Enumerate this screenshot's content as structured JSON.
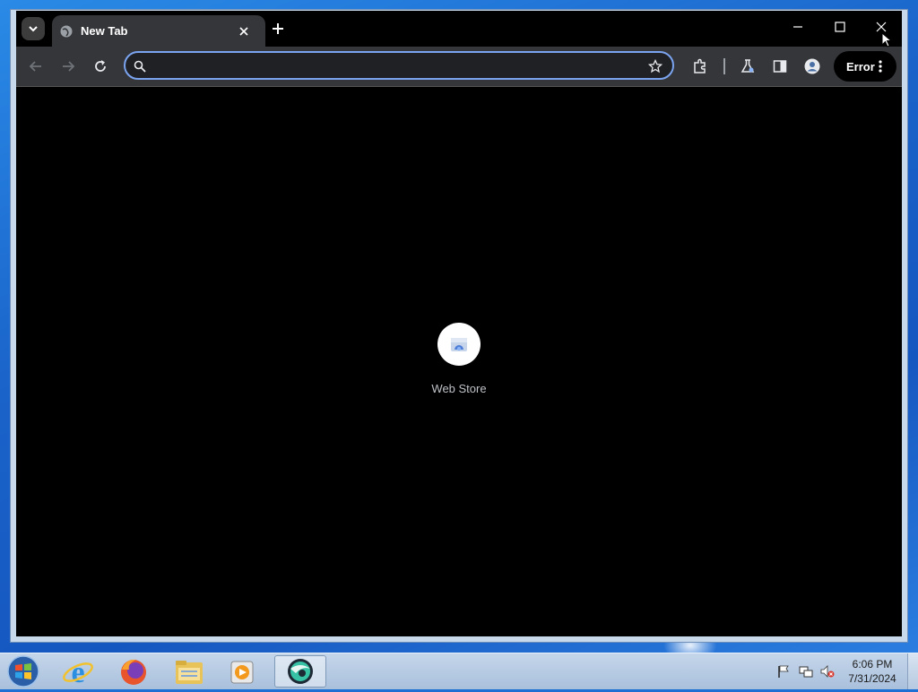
{
  "browser": {
    "tab": {
      "title": "New Tab"
    },
    "omnibox": {
      "value": "",
      "placeholder": ""
    },
    "profile_button_label": "Error"
  },
  "new_tab_page": {
    "shortcuts": [
      {
        "label": "Web Store",
        "icon": "web-store-icon"
      }
    ]
  },
  "taskbar": {
    "apps": [
      "internet-explorer-icon",
      "firefox-icon",
      "file-explorer-icon",
      "media-player-icon",
      "browser-app-icon"
    ],
    "tray_icons": [
      "action-center-flag-icon",
      "network-icon",
      "volume-muted-icon"
    ],
    "clock": {
      "time": "6:06 PM",
      "date": "7/31/2024"
    }
  },
  "colors": {
    "accent": "#7ba4f0",
    "toolbar_bg": "#35363a",
    "page_bg": "#000000"
  }
}
